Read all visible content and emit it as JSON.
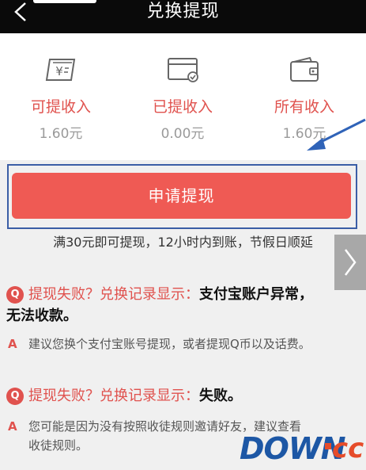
{
  "header": {
    "title": "兑换提现",
    "back_icon": "chevron-left-icon"
  },
  "stats": [
    {
      "label": "可提收入",
      "value": "1.60元",
      "icon": "yuan-bill-icon"
    },
    {
      "label": "已提收入",
      "value": "0.00元",
      "icon": "card-check-icon"
    },
    {
      "label": "所有收入",
      "value": "1.60元",
      "icon": "wallet-icon"
    }
  ],
  "apply": {
    "button_label": "申请提现",
    "notice": "满30元即可提现，12小时内到账，节假日顺延"
  },
  "faq": [
    {
      "q_badge": "Q",
      "q_prefix": "提现失败？兑换记录显示：",
      "q_reason": "支付宝账户异常，",
      "q_reason_line2": "无法收款。",
      "a_mark": "A",
      "answer": "建议您换个支付宝账号提现，或者提现Q币以及话费。"
    },
    {
      "q_badge": "Q",
      "q_prefix": "提现失败？兑换记录显示：",
      "q_reason": "失败。",
      "a_mark": "A",
      "answer": "您可能是因为没有按照收徒规则邀请好友，建议查看",
      "answer_line2": "收徒规则。"
    }
  ],
  "watermark": {
    "brand": "DOWN",
    "tld": "cc"
  },
  "colors": {
    "accent": "#ef5a54",
    "label_red": "#e0524e",
    "annotation_blue": "#3b5ea6",
    "topbar": "#0a0a0a"
  }
}
